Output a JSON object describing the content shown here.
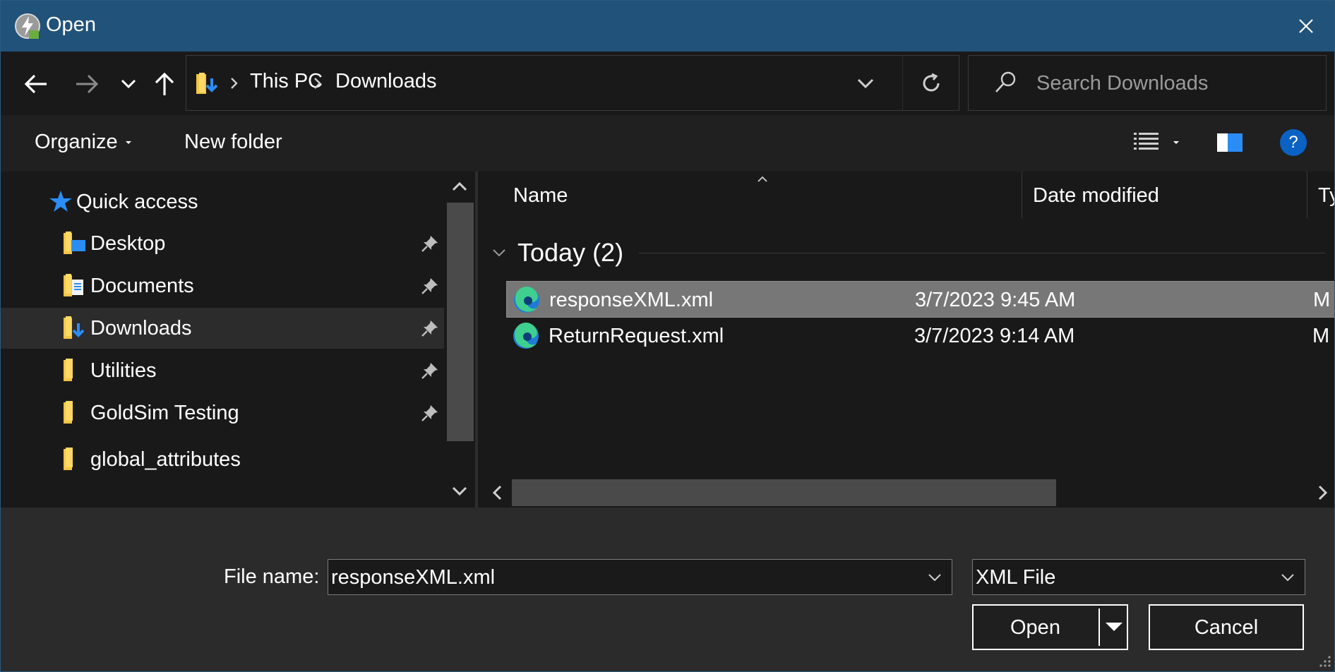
{
  "window": {
    "title": "Open",
    "icon": "goldsim-icon",
    "close_icon": "close-icon"
  },
  "nav": {
    "back_icon": "arrow-left-icon",
    "forward_icon": "arrow-right-icon",
    "recent_icon": "chevron-down-icon",
    "up_icon": "arrow-up-icon"
  },
  "address": {
    "icon": "downloads-folder-icon",
    "breadcrumbs": [
      {
        "label": "This PC"
      },
      {
        "label": "Downloads"
      }
    ],
    "dropdown_icon": "chevron-down-icon",
    "refresh_icon": "refresh-icon"
  },
  "search": {
    "placeholder": "Search Downloads",
    "icon": "search-icon"
  },
  "toolbar": {
    "organize_label": "Organize",
    "new_folder_label": "New folder",
    "view_icon": "details-view-icon",
    "preview_icon": "preview-pane-icon",
    "help_label": "?"
  },
  "navpane": {
    "quick_access": {
      "label": "Quick access",
      "icon": "star-icon"
    },
    "items": [
      {
        "label": "Desktop",
        "icon": "desktop-folder-icon",
        "pinned": true
      },
      {
        "label": "Documents",
        "icon": "documents-folder-icon",
        "pinned": true
      },
      {
        "label": "Downloads",
        "icon": "downloads-folder-icon",
        "pinned": true,
        "selected": true
      },
      {
        "label": "Utilities",
        "icon": "folder-icon",
        "pinned": true
      },
      {
        "label": "GoldSim Testing",
        "icon": "folder-icon",
        "pinned": true
      },
      {
        "label": "global_attributes",
        "icon": "folder-icon",
        "pinned": false
      }
    ]
  },
  "files": {
    "columns": {
      "name": "Name",
      "date": "Date modified",
      "type": "Ty"
    },
    "group": {
      "label": "Today (2)"
    },
    "rows": [
      {
        "name": "responseXML.xml",
        "date": "3/7/2023 9:45 AM",
        "type": "M",
        "icon": "edge-icon",
        "selected": true
      },
      {
        "name": "ReturnRequest.xml",
        "date": "3/7/2023 9:14 AM",
        "type": "M",
        "icon": "edge-icon",
        "selected": false
      }
    ]
  },
  "footer": {
    "file_name_label": "File name:",
    "file_name_value": "responseXML.xml",
    "file_type_value": "XML File",
    "open_label": "Open",
    "cancel_label": "Cancel"
  },
  "colors": {
    "titlebar": "#21527a",
    "background": "#191919",
    "selection": "#777777",
    "help_blue": "#0a62c4",
    "folder_yellow": "#f4c542"
  }
}
